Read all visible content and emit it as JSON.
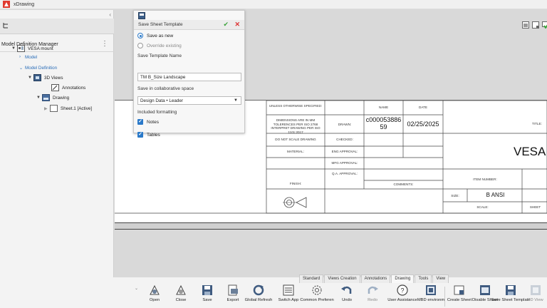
{
  "app": {
    "title": "xDrawing"
  },
  "left_panel": {
    "header": "Model Definition Manager",
    "tree": [
      {
        "label": "VESA mount",
        "icon": "assembly-icon"
      },
      {
        "label": "Model",
        "icon": ""
      },
      {
        "label": "Model Definition",
        "icon": ""
      },
      {
        "label": "3D Views",
        "icon": "view3d-icon"
      },
      {
        "label": "Annotations",
        "icon": "annotation-icon"
      },
      {
        "label": "Drawing",
        "icon": "drawing-icon"
      },
      {
        "label": "Sheet.1 [Active]",
        "icon": "sheet-icon"
      }
    ]
  },
  "dialog": {
    "title": "Save Sheet Template",
    "option_save_new": "Save as new",
    "option_override": "Override existing",
    "name_label": "Save Template Name",
    "name_value": "TM B_Size Landscape",
    "space_label": "Save in collaborative space",
    "space_value": "Design Data • Leader",
    "formatting_label": "Included formatting",
    "notes_label": "Notes",
    "tables_label": "Tables"
  },
  "title_block": {
    "unless": "UNLESS OTHERWISE SPECIFIED:",
    "dims": "DIMENSIONS ARE IN MM TOLERENCES PER ISO 2768 INTERPRET DRAWING PER ISO 1101:2017",
    "no_scale": "DO NOT SCALE DRAWING",
    "material": "MATERIAL:",
    "finish": "FINISH:",
    "name_hdr": "NAME",
    "date_hdr": "DATE",
    "drawn": "DRAWN:",
    "drawn_name": "c000053886 59",
    "drawn_date": "02/25/2025",
    "checked": "CHECKED:",
    "eng_approval": "ENG APPROVAL:",
    "mfg_approval": "MFG APPROVAL:",
    "qa_approval": "Q.A. APPROVAL:",
    "comments": "COMMENTS:",
    "title_label": "TITLE:",
    "title_value": "VESA r",
    "item_number": "ITEM NUMBER:",
    "size_label": "SIZE:",
    "size_value": "B ANSI",
    "scale_label": "SCALE:",
    "sheet_label": "SHEET"
  },
  "ribbon": {
    "tabs": [
      "Standard",
      "Views Creation",
      "Annotations",
      "Drawing",
      "Tools",
      "View"
    ],
    "active_tab": "Drawing",
    "tools": [
      {
        "label": "Open",
        "icon": "open-icon"
      },
      {
        "label": "Close",
        "icon": "close-doc-icon"
      },
      {
        "label": "Save",
        "icon": "save-icon"
      },
      {
        "label": "Export",
        "icon": "export-icon"
      },
      {
        "label": "Global Refresh",
        "icon": "refresh-icon"
      },
      {
        "label": "Switch App",
        "icon": "switch-app-icon"
      },
      {
        "label": "Common Preferen",
        "icon": "preferences-icon"
      },
      {
        "label": "Undo",
        "icon": "undo-icon"
      },
      {
        "label": "Redo",
        "icon": "redo-icon"
      },
      {
        "label": "User Assistance",
        "icon": "help-icon"
      },
      {
        "label": "MBD environm",
        "icon": "mbd-icon"
      },
      {
        "label": "Create Sheet",
        "icon": "create-sheet-icon"
      },
      {
        "label": "Disable Sheet",
        "icon": "disable-sheet-icon"
      },
      {
        "label": "Save Sheet Template",
        "icon": "save-template-icon"
      },
      {
        "label": "2D View",
        "icon": "view2d-icon"
      }
    ]
  }
}
